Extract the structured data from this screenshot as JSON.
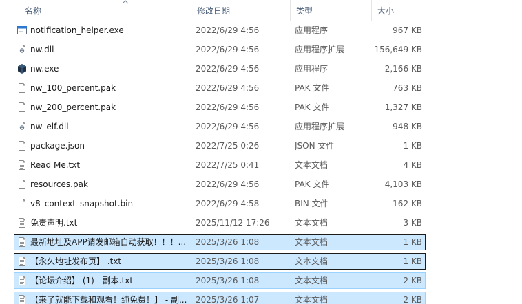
{
  "columns": {
    "name": "名称",
    "date": "修改日期",
    "type": "类型",
    "size": "大小"
  },
  "files": [
    {
      "name": "notification_helper.exe",
      "date": "2022/6/29 4:56",
      "type": "应用程序",
      "size": "967 KB",
      "icon": "app-window-icon"
    },
    {
      "name": "nw.dll",
      "date": "2022/6/29 4:56",
      "type": "应用程序扩展",
      "size": "156,649 KB",
      "icon": "dll-file-icon"
    },
    {
      "name": "nw.exe",
      "date": "2022/6/29 4:56",
      "type": "应用程序",
      "size": "2,166 KB",
      "icon": "nw-app-icon"
    },
    {
      "name": "nw_100_percent.pak",
      "date": "2022/6/29 4:56",
      "type": "PAK 文件",
      "size": "763 KB",
      "icon": "blank-file-icon"
    },
    {
      "name": "nw_200_percent.pak",
      "date": "2022/6/29 4:56",
      "type": "PAK 文件",
      "size": "1,327 KB",
      "icon": "blank-file-icon"
    },
    {
      "name": "nw_elf.dll",
      "date": "2022/6/29 4:56",
      "type": "应用程序扩展",
      "size": "948 KB",
      "icon": "dll-file-icon"
    },
    {
      "name": "package.json",
      "date": "2022/7/25 0:26",
      "type": "JSON 文件",
      "size": "1 KB",
      "icon": "blank-file-icon"
    },
    {
      "name": "Read Me.txt",
      "date": "2022/7/25 0:41",
      "type": "文本文档",
      "size": "4 KB",
      "icon": "text-file-icon"
    },
    {
      "name": "resources.pak",
      "date": "2022/6/29 4:56",
      "type": "PAK 文件",
      "size": "4,103 KB",
      "icon": "blank-file-icon"
    },
    {
      "name": "v8_context_snapshot.bin",
      "date": "2022/6/29 4:58",
      "type": "BIN 文件",
      "size": "162 KB",
      "icon": "blank-file-icon"
    },
    {
      "name": "免责声明.txt",
      "date": "2025/11/12 17:26",
      "type": "文本文档",
      "size": "3 KB",
      "icon": "text-file-icon"
    },
    {
      "name": "最新地址及APP请发邮箱自动获取！！！...",
      "date": "2025/3/26 1:08",
      "type": "文本文档",
      "size": "1 KB",
      "icon": "text-file-icon",
      "state": "focused"
    },
    {
      "name": "【永久地址发布页】 .txt",
      "date": "2025/3/26 1:08",
      "type": "文本文档",
      "size": "1 KB",
      "icon": "text-file-icon",
      "state": "focused"
    },
    {
      "name": "【论坛介绍】 (1) - 副本.txt",
      "date": "2025/3/26 1:08",
      "type": "文本文档",
      "size": "2 KB",
      "icon": "text-file-icon",
      "state": "selected"
    },
    {
      "name": "【来了就能下载和观看！纯免费！】 - 副...",
      "date": "2025/3/26 1:07",
      "type": "文本文档",
      "size": "2 KB",
      "icon": "text-file-icon",
      "state": "selected"
    }
  ]
}
